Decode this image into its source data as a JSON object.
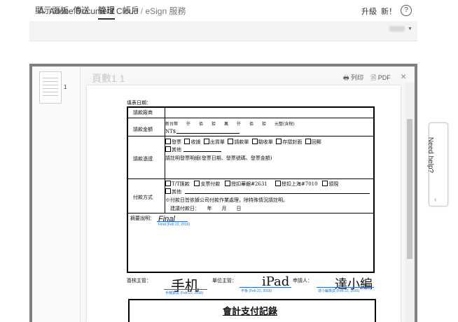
{
  "topbar": {
    "brand": "Adobe Document Cloud",
    "separator": "/",
    "product": "eSign 服務",
    "upgrade": "升級",
    "new": "新！",
    "help": "?"
  },
  "nav": {
    "tabs": [
      "顯示面板",
      "傳送",
      "管理",
      "帳戶"
    ],
    "active": "管理"
  },
  "viewer": {
    "thumb_page": "1",
    "page_header": "頁數1 1",
    "print": "列印",
    "pdf": "PDF",
    "close": "×"
  },
  "form": {
    "date": "填表日期：",
    "vendor": "請款廠商",
    "amount_label": "請款金額",
    "amount_text": "新台幣　　仟　　佰　　拾　　萬　　仟　　佰　　拾　　元整(含稅)",
    "nts": "NT$",
    "voucher_label": "請款憑證",
    "voucher_opts": [
      "發票",
      "收據",
      "出貨單",
      "請款單",
      "驗收單",
      "存摺封面",
      "回郵"
    ],
    "voucher_other": "其他",
    "voucher_note": "請註明發票明細(發票日期、發票號碼、發票金額)",
    "pay_label": "付款方式",
    "pay_opts": [
      "T/T匯款",
      "支票付款",
      "授扣華銀#2631",
      "授扣上海#7010",
      "領現"
    ],
    "pay_other": "其他",
    "pay_note": "※付款日皆依據公司付款作業處理，除特殊情況請註明。",
    "pay_date": "建議付款日：　　年　　月　　日",
    "summary_label": "摘要說明：",
    "summary_sig": "Final",
    "summary_stamp": "Final (Feb 22, 2016)",
    "approver": "簽核主管：",
    "dept": "單位主管：",
    "applicant": "申請人：",
    "sig1": "手机",
    "sig1_stamp": "手機簽試 (Feb 22, 2016)",
    "sig2": "iPad",
    "sig2_stamp": "平板 (Feb 22, 2016)",
    "sig3": "達小編",
    "sig3_stamp": "達小編簽試 (Feb 22, 2016)",
    "footer_title": "會計支付記錄"
  },
  "needhelp": {
    "label": "Need help?",
    "arrow": "‹"
  },
  "colors": {
    "accent_blue": "#1e6fd0",
    "viewer_border": "#808080"
  }
}
